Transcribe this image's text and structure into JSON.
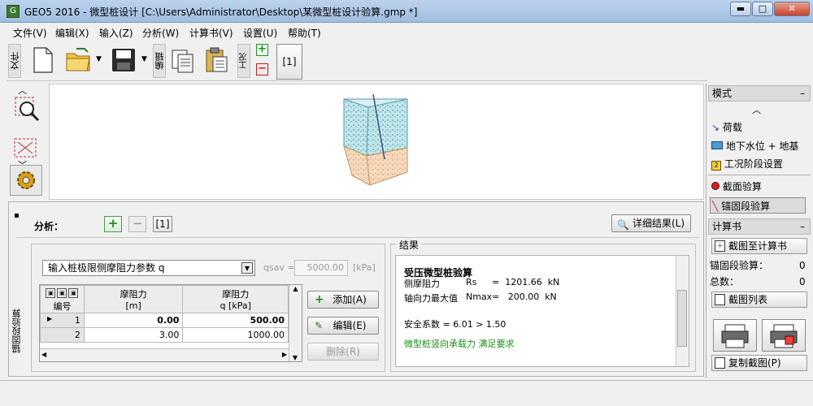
{
  "window": {
    "title": "GEO5 2016 - 微型桩设计 [C:\\Users\\Administrator\\Desktop\\某微型桩设计验算.gmp *]",
    "logo": "G",
    "minimize": "▬",
    "maximize": "□",
    "close": "✕"
  },
  "menu": [
    "文件(V)",
    "编辑(X)",
    "输入(Z)",
    "分析(W)",
    "计算书(V)",
    "设置(U)",
    "帮助(T)"
  ],
  "toolbar": {
    "file_label": "文件",
    "edit_label": "编辑",
    "stage_label": "工况",
    "stage_number": "[1]"
  },
  "right_panel": {
    "mode_header": "模式",
    "mode_items": [
      "荷载",
      "地下水位 + 地基",
      "工况阶段设置",
      "截面验算",
      "锚固段验算"
    ],
    "report_header": "计算书",
    "add_to_report": "截图至计算书",
    "anchor_check_label": "锚固段验算：",
    "anchor_check_value": "0",
    "total_label": "总数：",
    "total_value": "0",
    "screenshot_list": "截图列表",
    "copy_screenshot": "复制截图(P)"
  },
  "analysis": {
    "vertical_tab": "锚固段验算",
    "label": "分析：",
    "stage_number": "[1]",
    "detail_results": "详细结果(L)",
    "dropdown_value": "输入桩极限侧摩阻力参数 q",
    "qsav_label": "qsav =",
    "qsav_value": "5000.00",
    "qsav_unit": "[kPa]",
    "table": {
      "headers": [
        [
          "编号",
          ""
        ],
        [
          "摩阻力",
          "[m]"
        ],
        [
          "摩阻力",
          "q  [kPa]"
        ]
      ],
      "rows": [
        {
          "num": "1",
          "depth": "0.00",
          "q": "500.00"
        },
        {
          "num": "2",
          "depth": "3.00",
          "q": "1000.00"
        }
      ]
    },
    "add_button": "添加(A)",
    "edit_button": "编辑(E)",
    "delete_button": "删除(R)"
  },
  "results": {
    "group_label": "结果",
    "title": "受压微型桩验算",
    "line1_label": "侧摩阻力",
    "line1_symbol": "Rs",
    "line1_value": "=  1201.66  kN",
    "line2_label": "轴向力最大值",
    "line2_symbol": "Nmax",
    "line2_value": "=   200.00  kN",
    "safety": "安全系数 = 6.01 > 1.50",
    "conclusion": "微型桩竖向承载力 满足要求"
  },
  "colors": {
    "accent_green": "#1a8f1a",
    "soil_top": "#8fd0d8",
    "soil_bottom": "#f0c8a0"
  }
}
